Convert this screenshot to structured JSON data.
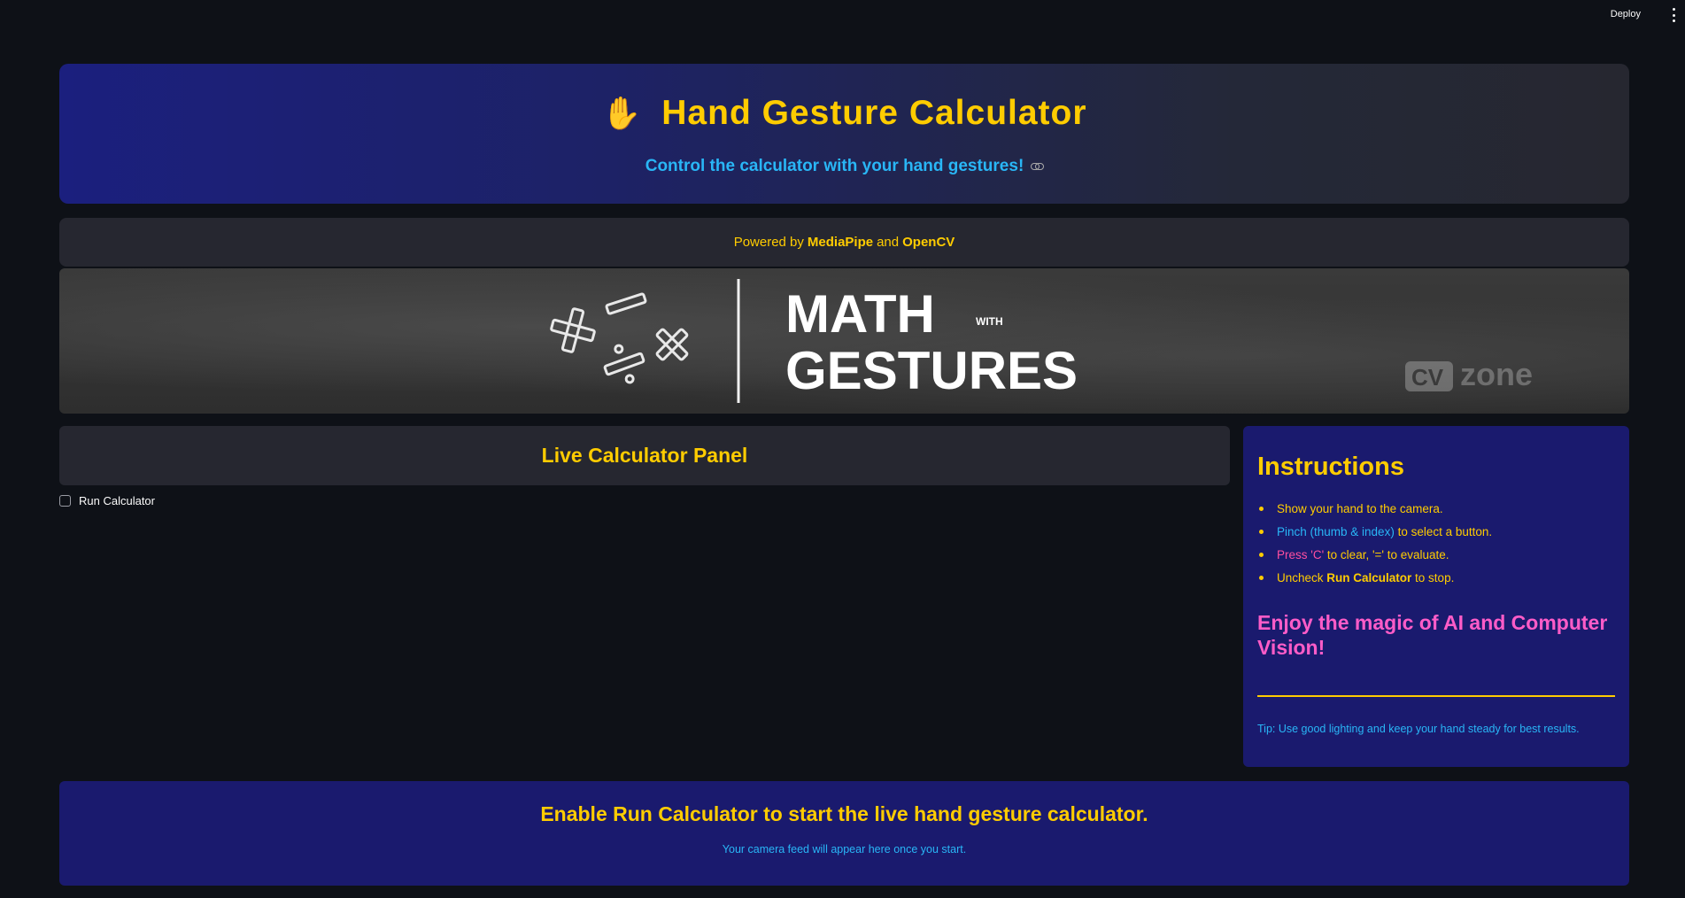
{
  "topbar": {
    "deploy_label": "Deploy",
    "menu_icon": "kebab-menu-icon"
  },
  "header": {
    "icon": "raised-hand-icon",
    "icon_glyph": "✋",
    "title": "Hand Gesture Calculator",
    "subtitle": "Control the calculator with your hand gestures!",
    "link_icon": "link-icon"
  },
  "powered": {
    "prefix": "Powered by",
    "lib1": "MediaPipe",
    "joiner": "and",
    "lib2": "OpenCV"
  },
  "banner": {
    "line1": "MATH",
    "small": "WITH",
    "line2": "GESTURES",
    "brand_box": "CV",
    "brand_text": "zone",
    "symbols": [
      "+",
      "−",
      "×",
      "÷"
    ]
  },
  "live_panel": {
    "title": "Live Calculator Panel"
  },
  "run_toggle": {
    "label": "Run Calculator",
    "checked": false
  },
  "instructions": {
    "title": "Instructions",
    "items": [
      {
        "text": "Show your hand to the camera."
      },
      {
        "highlight": "Pinch (thumb & index)",
        "rest": " to select a button."
      },
      {
        "highlight": "Press 'C'",
        "rest": " to clear, '=' to evaluate."
      },
      {
        "before": "Uncheck ",
        "bold": "Run Calculator",
        "after": " to stop."
      }
    ],
    "enjoy": "Enjoy the magic of AI and Computer Vision!",
    "tip": "Tip: Use good lighting and keep your hand steady for best results."
  },
  "footer_card": {
    "title": "Enable Run Calculator to start the live hand gesture calculator.",
    "subtitle": "Your camera feed will appear here once you start."
  },
  "colors": {
    "background": "#0e1117",
    "accent_yellow": "#ffcc00",
    "accent_blue": "#29b6f6",
    "accent_pink": "#ff4fa0",
    "card_navy": "#1a1a6e",
    "card_gray": "#262730"
  }
}
